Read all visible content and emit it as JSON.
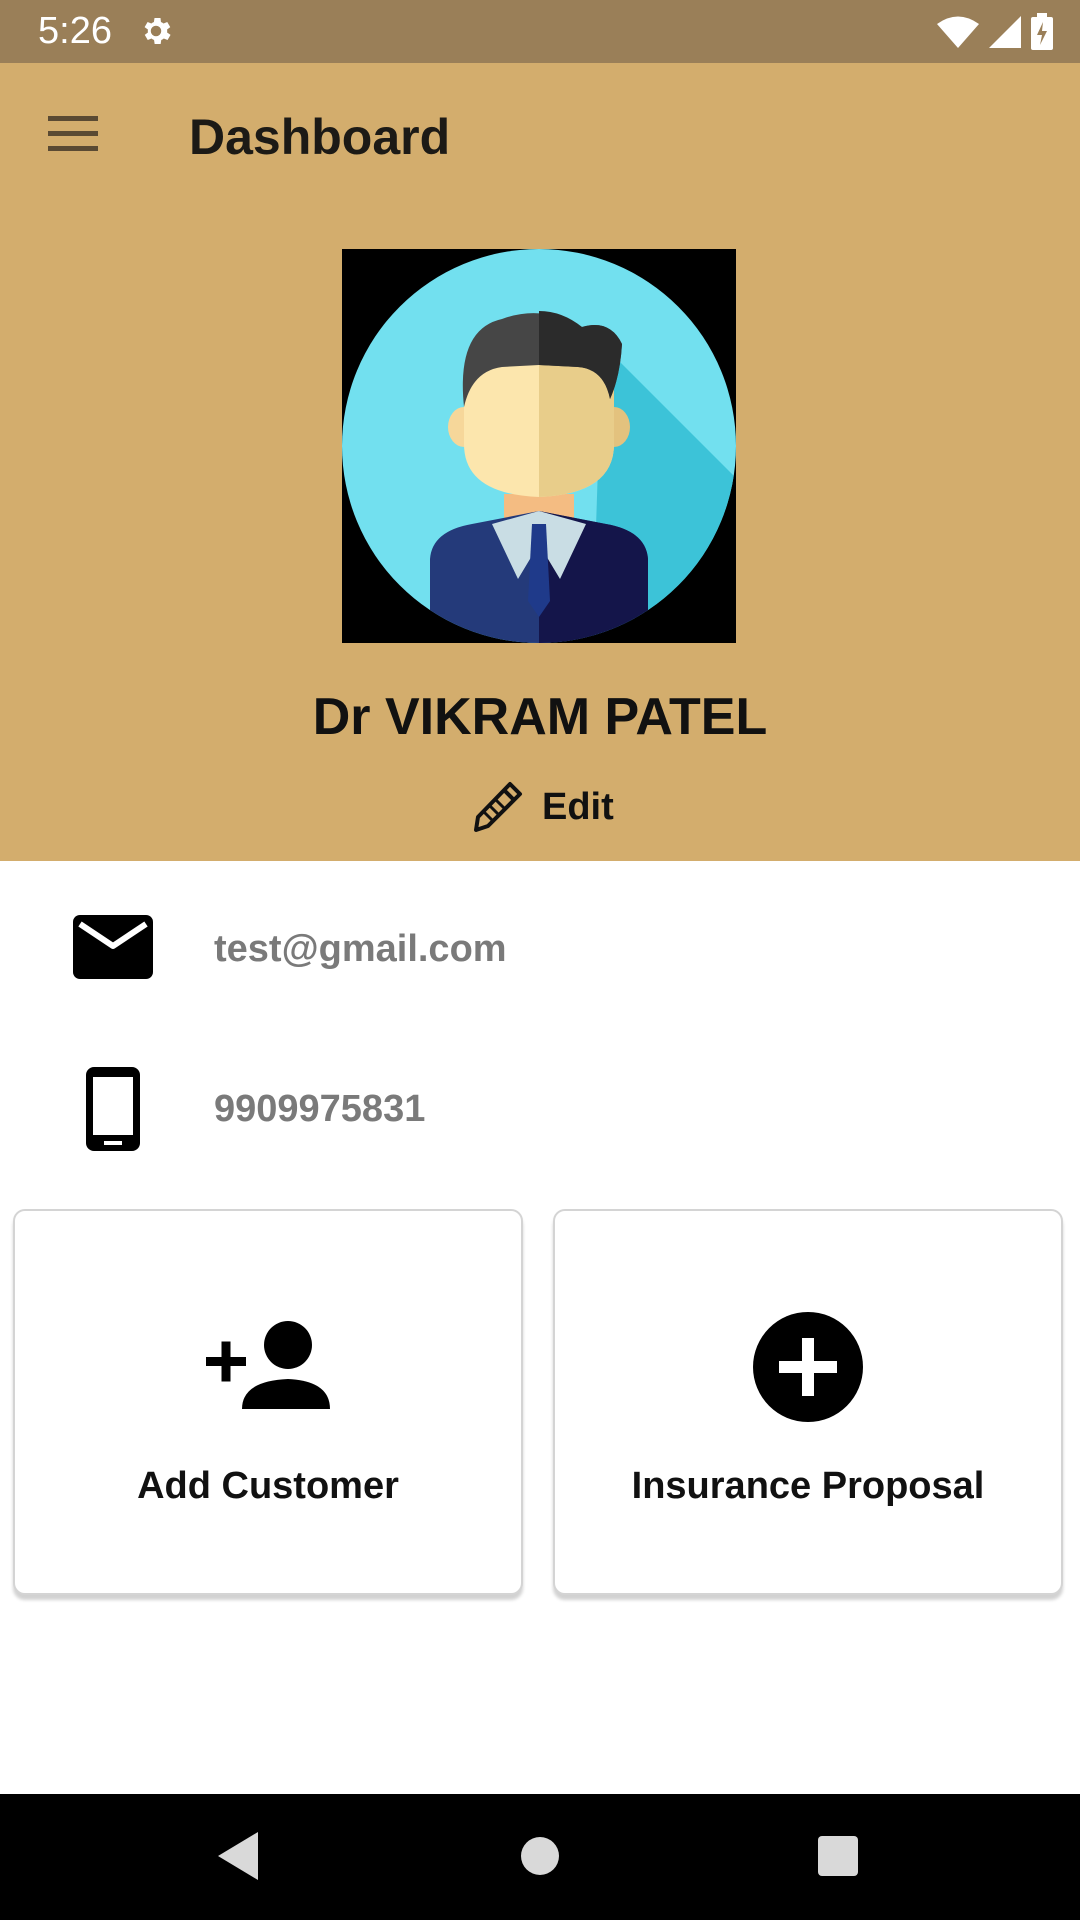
{
  "status_bar": {
    "time": "5:26",
    "icons": [
      "gear-icon",
      "wifi-icon",
      "cellular-signal-icon",
      "battery-icon"
    ]
  },
  "appbar": {
    "title": "Dashboard",
    "menu_icon": "hamburger-menu-icon",
    "background_color": "#d3ad6d"
  },
  "profile": {
    "name": "Dr VIKRAM PATEL",
    "edit_label": "Edit",
    "avatar_icon": "man-avatar-icon"
  },
  "contact": {
    "email": "test@gmail.com",
    "phone": "9909975831"
  },
  "actions": [
    {
      "label": "Add Customer",
      "icon": "add-person-icon"
    },
    {
      "label": "Insurance Proposal",
      "icon": "plus-circle-icon"
    }
  ],
  "navigation_bar": {
    "buttons": [
      "back-icon",
      "home-icon",
      "recents-icon"
    ]
  }
}
